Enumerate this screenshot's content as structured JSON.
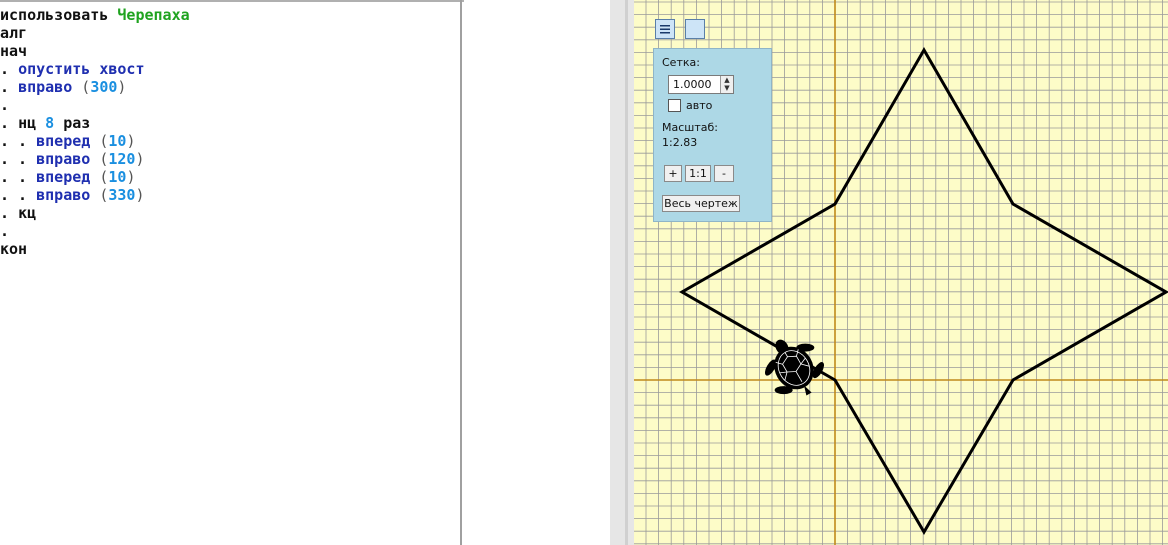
{
  "code": {
    "line1": {
      "kw": "использовать",
      "mod": "Черепаха"
    },
    "line2": "алг",
    "line3": "нач",
    "line4": {
      "dot": ". ",
      "cmd": "опустить хвост"
    },
    "line5": {
      "dot": ". ",
      "cmd": "вправо",
      "arg": "300"
    },
    "line6": ".",
    "line7": {
      "dot": ". ",
      "kw": "нц",
      "num": "8",
      "kw2": "раз"
    },
    "line8": {
      "dot": ". . ",
      "cmd": "вперед",
      "arg": "10"
    },
    "line9": {
      "dot": ". . ",
      "cmd": "вправо",
      "arg": "120"
    },
    "line10": {
      "dot": ". . ",
      "cmd": "вперед",
      "arg": "10"
    },
    "line11": {
      "dot": ". . ",
      "cmd": "вправо",
      "arg": "330"
    },
    "line12": {
      "dot": ". ",
      "kw": "кц"
    },
    "line13": ".",
    "line14": "кон"
  },
  "panel": {
    "grid_label": "Сетка:",
    "grid_value": "1.0000",
    "auto_label": "авто",
    "auto_checked": false,
    "scale_label": "Масштаб:",
    "scale_value": "1:2.83",
    "zoom_in": "+",
    "zoom_reset": "1:1",
    "zoom_out": "-",
    "fit_all": "Весь чертеж"
  },
  "toolbar": {
    "menu_icon": "menu-icon",
    "view_icon": "square-icon"
  },
  "colors": {
    "grid_bg": "#fdfcc8",
    "grid_line": "#9a9a9a",
    "axis": "#c08a1a",
    "panel_bg": "#add8e6"
  }
}
